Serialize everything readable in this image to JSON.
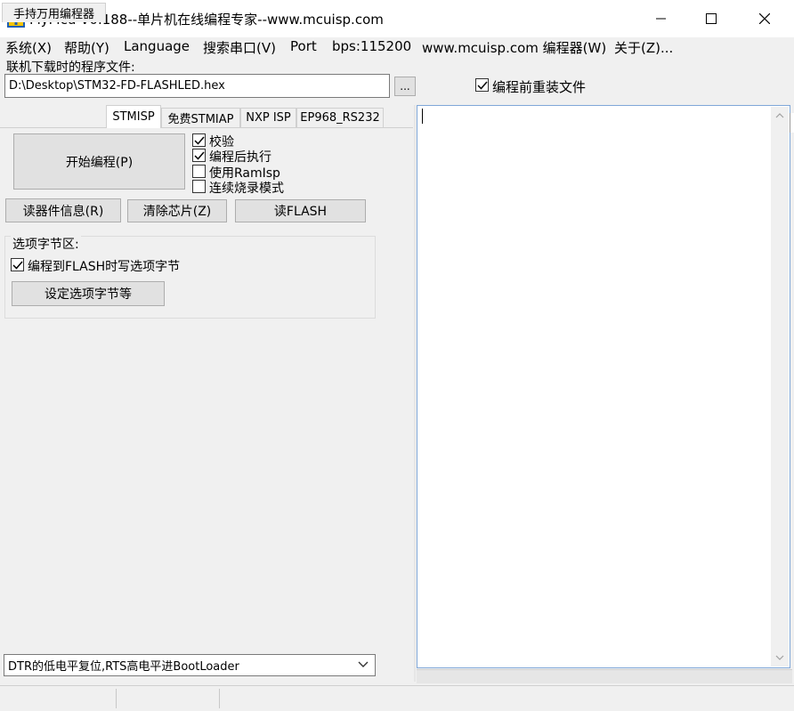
{
  "window": {
    "title": "FlyMcu V0.188--单片机在线编程专家--www.mcuisp.com"
  },
  "menu": {
    "items": [
      {
        "label": "系统(X)"
      },
      {
        "label": "帮助(Y)"
      },
      {
        "label": "Language"
      },
      {
        "label": "搜索串口(V)"
      },
      {
        "label": "Port"
      },
      {
        "label": "bps:115200"
      },
      {
        "label": "www.mcuisp.com 编程器(W)"
      },
      {
        "label": "关于(Z)..."
      }
    ]
  },
  "file": {
    "label": "联机下载时的程序文件:",
    "path": "D:\\Desktop\\STM32-FD-FLASHLED.hex",
    "browse_label": "...",
    "reload_label": "编程前重装文件",
    "reload_checked": true
  },
  "tabs": [
    {
      "label": "手持万用编程器",
      "active": false
    },
    {
      "label": "STMISP",
      "active": true
    },
    {
      "label": "免费STMIAP",
      "active": false
    },
    {
      "label": "NXP ISP",
      "active": false
    },
    {
      "label": "EP968_RS232",
      "active": false
    }
  ],
  "stmisp": {
    "start_label": "开始编程(P)",
    "options": [
      {
        "label": "校验",
        "checked": true
      },
      {
        "label": "编程后执行",
        "checked": true
      },
      {
        "label": "使用RamIsp",
        "checked": false
      },
      {
        "label": "连续烧录模式",
        "checked": false
      }
    ],
    "read_info_label": "读器件信息(R)",
    "erase_label": "清除芯片(Z)",
    "read_flash_label": "读FLASH",
    "option_bytes": {
      "group_label": "选项字节区:",
      "write_label": "编程到FLASH时写选项字节",
      "write_checked": true,
      "set_label": "设定选项字节等"
    }
  },
  "boot_mode": {
    "selected": "DTR的低电平复位,RTS高电平进BootLoader"
  },
  "colors": {
    "accent_border": "#7fa7d8",
    "window_bg": "#f0f0f0",
    "button_bg": "#e1e1e1"
  }
}
